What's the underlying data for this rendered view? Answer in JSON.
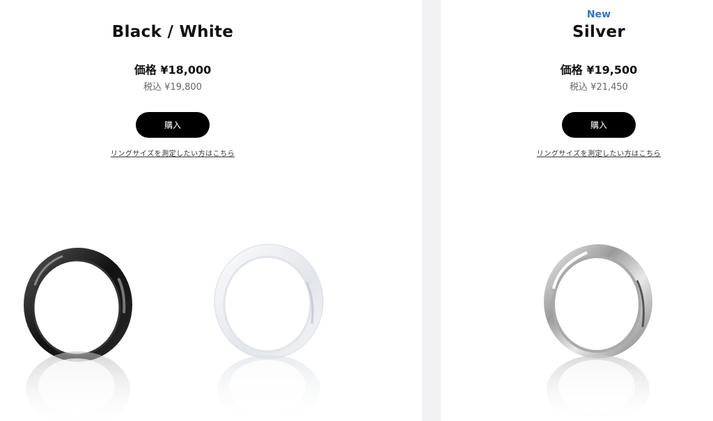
{
  "products": [
    {
      "badge": "",
      "title": "Black / White",
      "price": "価格 ¥18,000",
      "tax_price": "税込 ¥19,800",
      "buy_label": "購入",
      "size_link": "リングサイズを測定したい方はこちら",
      "images": [
        "black-ring-image",
        "white-ring-image"
      ]
    },
    {
      "badge": "New",
      "title": "Silver",
      "price": "価格 ¥19,500",
      "tax_price": "税込 ¥21,450",
      "buy_label": "購入",
      "size_link": "リングサイズを測定したい方はこちら",
      "images": [
        "silver-ring-image"
      ]
    }
  ],
  "colors": {
    "badge": "#2f73c9",
    "button": "#000000",
    "divider": "#f2f2f4"
  }
}
